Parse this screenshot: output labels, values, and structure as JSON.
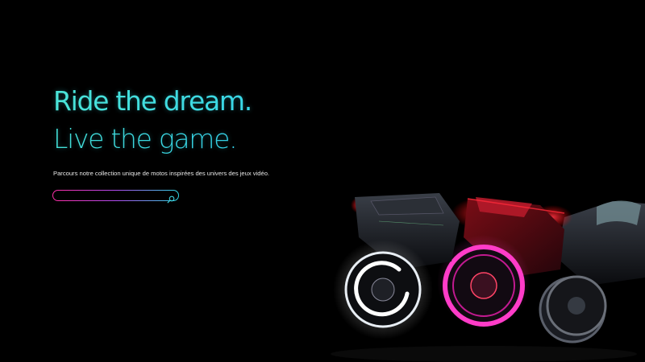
{
  "hero": {
    "headline_line1": "Ride the dream.",
    "headline_line2": "Live the game.",
    "tagline": "Parcours notre collection unique de motos inspirées des univers des jeux vidéo."
  },
  "search": {
    "value": "",
    "placeholder": "",
    "icon": "search-icon"
  },
  "colors": {
    "background": "#000000",
    "headline_cyan": "#3fe0d8",
    "accent_pink": "#ff2ea6",
    "accent_cyan": "#2fd8e6"
  },
  "hero_image": {
    "subject": "three neon-lit motorcycles"
  }
}
